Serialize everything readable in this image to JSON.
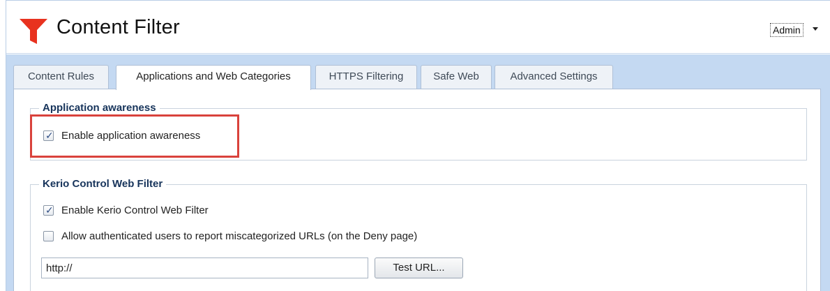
{
  "header": {
    "title": "Content Filter",
    "logo_icon": "funnel-icon",
    "logo_color": "#e8321f",
    "user_menu": "Admin"
  },
  "tabs": [
    {
      "label": "Content Rules",
      "active": false
    },
    {
      "label": "Applications and Web Categories",
      "active": true
    },
    {
      "label": "HTTPS Filtering",
      "active": false
    },
    {
      "label": "Safe Web",
      "active": false
    },
    {
      "label": "Advanced Settings",
      "active": false
    }
  ],
  "app_awareness": {
    "legend": "Application awareness",
    "enable_label": "Enable application awareness",
    "enable_checked": true
  },
  "web_filter": {
    "legend": "Kerio Control Web Filter",
    "enable_label": "Enable Kerio Control Web Filter",
    "enable_checked": true,
    "report_label": "Allow authenticated users to report miscategorized URLs (on the Deny page)",
    "report_checked": false,
    "url_value": "http://",
    "test_button": "Test URL..."
  },
  "colors": {
    "accent_blue": "#c4d9f2",
    "legend_text": "#17345b",
    "highlight": "#d9423c"
  }
}
